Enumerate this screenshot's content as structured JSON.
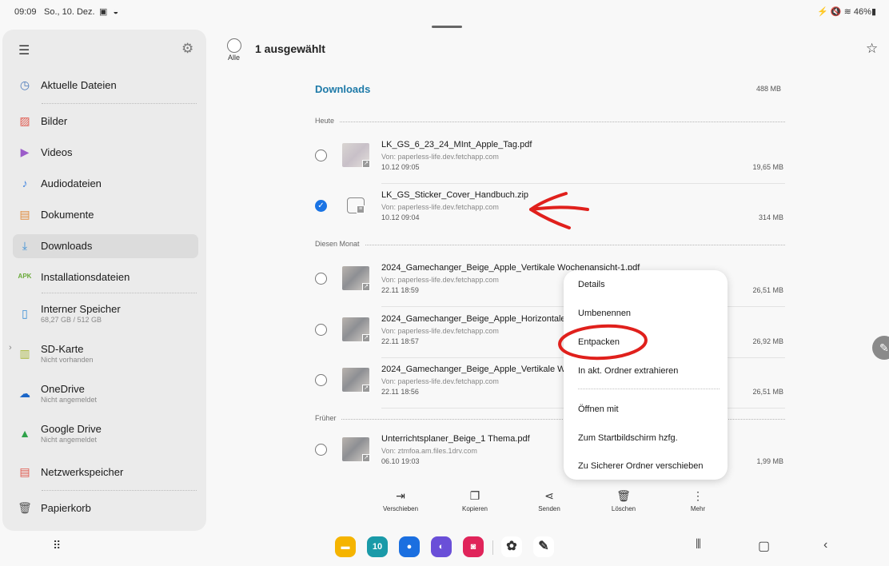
{
  "status": {
    "time": "09:09",
    "date": "So., 10. Dez.",
    "battery": "46%",
    "left_icons": "▣ ◒",
    "right_icons": "⚡ 🔇 ≋"
  },
  "sidebar": {
    "items": [
      {
        "label": "Aktuelle Dateien",
        "icon": "clock-icon",
        "glyph": "◷",
        "color": "#4a78b8"
      },
      {
        "label": "Bilder",
        "icon": "image-icon",
        "glyph": "▨",
        "color": "#e0584d"
      },
      {
        "label": "Videos",
        "icon": "video-icon",
        "glyph": "▶",
        "color": "#9b5cc9"
      },
      {
        "label": "Audiodateien",
        "icon": "music-icon",
        "glyph": "♪",
        "color": "#4a8ae0"
      },
      {
        "label": "Dokumente",
        "icon": "document-icon",
        "glyph": "▤",
        "color": "#e08a3a"
      },
      {
        "label": "Downloads",
        "icon": "download-icon",
        "glyph": "⤓",
        "color": "#3b8fd6"
      },
      {
        "label": "Installationsdateien",
        "icon": "apk-icon",
        "glyph": "APK",
        "color": "#6aaa3a"
      },
      {
        "label": "Interner Speicher",
        "sub": "68,27 GB / 512 GB",
        "icon": "phone-icon",
        "glyph": "▯",
        "color": "#3b8fd6"
      },
      {
        "label": "SD-Karte",
        "sub": "Nicht vorhanden",
        "icon": "sdcard-icon",
        "glyph": "▥",
        "color": "#a8b63a"
      },
      {
        "label": "OneDrive",
        "sub": "Nicht angemeldet",
        "icon": "onedrive-icon",
        "glyph": "☁",
        "color": "#1a66c8"
      },
      {
        "label": "Google Drive",
        "sub": "Nicht angemeldet",
        "icon": "google-drive-icon",
        "glyph": "▲",
        "color": "#2fa24a"
      },
      {
        "label": "Netzwerkspeicher",
        "icon": "network-storage-icon",
        "glyph": "▤",
        "color": "#e0584d"
      },
      {
        "label": "Papierkorb",
        "icon": "trash-icon",
        "glyph": "🗑",
        "color": "#555555"
      }
    ]
  },
  "header": {
    "select_all": "Alle",
    "selected_count": "1 ausgewählt"
  },
  "content": {
    "folder_title": "Downloads",
    "folder_size": "488 MB",
    "sections": [
      "Heute",
      "Diesen Monat",
      "Früher"
    ],
    "files": [
      {
        "name": "LK_GS_6_23_24_MInt_Apple_Tag.pdf",
        "source": "Von: paperless-life.dev.fetchapp.com",
        "date": "10.12 09:05",
        "size": "19,65 MB",
        "checked": false
      },
      {
        "name": "LK_GS_Sticker_Cover_Handbuch.zip",
        "source": "Von: paperless-life.dev.fetchapp.com",
        "date": "10.12 09:04",
        "size": "314 MB",
        "checked": true
      },
      {
        "name": "2024_Gamechanger_Beige_Apple_Vertikale Wochenansicht-1.pdf",
        "source": "Von: paperless-life.dev.fetchapp.com",
        "date": "22.11 18:59",
        "size": "26,51 MB",
        "checked": false
      },
      {
        "name": "2024_Gamechanger_Beige_Apple_Horizontale",
        "source": "Von: paperless-life.dev.fetchapp.com",
        "date": "22.11 18:57",
        "size": "26,92 MB",
        "checked": false
      },
      {
        "name": "2024_Gamechanger_Beige_Apple_Vertikale W",
        "source": "Von: paperless-life.dev.fetchapp.com",
        "date": "22.11 18:56",
        "size": "26,51 MB",
        "checked": false
      },
      {
        "name": "Unterrichtsplaner_Beige_1 Thema.pdf",
        "source": "Von: ztmfoa.am.files.1drv.com",
        "date": "06.10 19:03",
        "size": "1,99 MB",
        "checked": false
      }
    ]
  },
  "actions": [
    {
      "label": "Verschieben",
      "icon": "move-icon",
      "glyph": "⇥"
    },
    {
      "label": "Kopieren",
      "icon": "copy-icon",
      "glyph": "❐"
    },
    {
      "label": "Senden",
      "icon": "share-icon",
      "glyph": "⋖"
    },
    {
      "label": "Löschen",
      "icon": "trash-icon",
      "glyph": "🗑"
    },
    {
      "label": "Mehr",
      "icon": "more-vertical-icon",
      "glyph": "⋮"
    }
  ],
  "context_menu": {
    "items": [
      "Details",
      "Umbenennen",
      "Entpacken",
      "In akt. Ordner extrahieren",
      "Öffnen mit",
      "Zum Startbildschirm hzfg.",
      "Zu Sicherer Ordner verschieben"
    ]
  },
  "dock": {
    "apps": [
      {
        "name": "files-app-icon",
        "color": "#f5b400",
        "glyph": "▬"
      },
      {
        "name": "calendar-app-icon",
        "color": "#1a9aa8",
        "glyph": "10"
      },
      {
        "name": "messages-app-icon",
        "color": "#1b6fe0",
        "glyph": "●"
      },
      {
        "name": "internet-app-icon",
        "color": "#6a4fd8",
        "glyph": "◐"
      },
      {
        "name": "camera-app-icon",
        "color": "#e0245a",
        "glyph": "◙"
      },
      {
        "name": "photos-app-icon",
        "color": "#ffffff",
        "glyph": "✿"
      },
      {
        "name": "notes-app-icon",
        "color": "#ffffff",
        "glyph": "✎"
      }
    ]
  }
}
